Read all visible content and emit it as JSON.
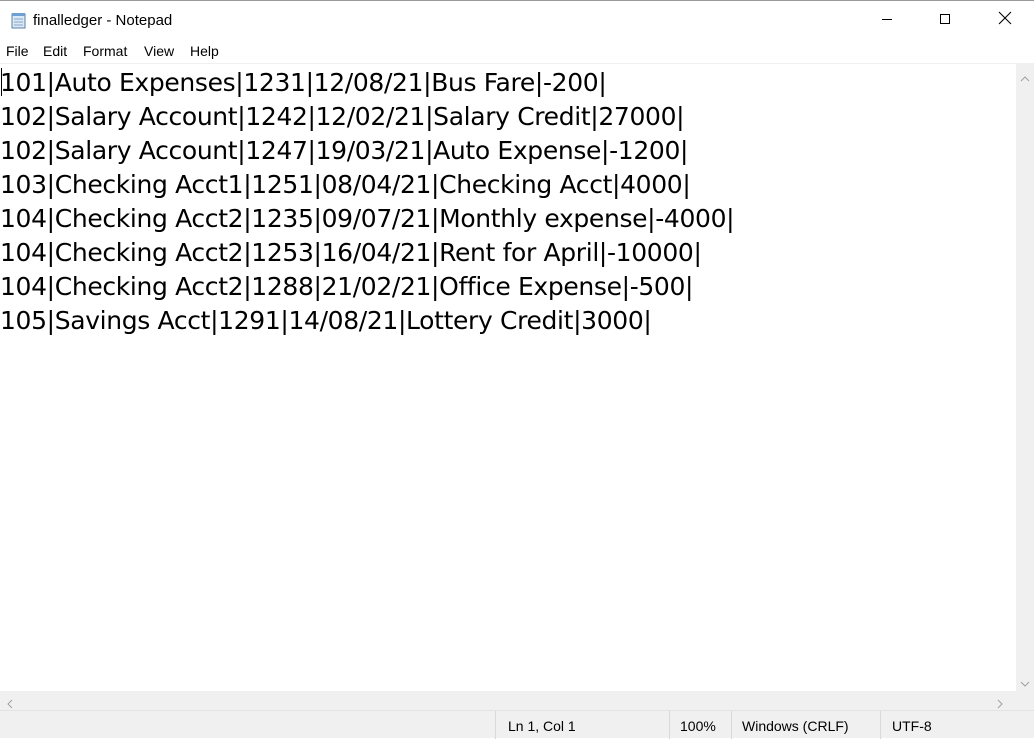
{
  "window": {
    "title": "finalledger - Notepad",
    "icon": "notepad-icon"
  },
  "controls": {
    "minimize_icon": "minimize-icon",
    "maximize_icon": "maximize-icon",
    "close_icon": "close-icon"
  },
  "menu": {
    "items": [
      "File",
      "Edit",
      "Format",
      "View",
      "Help"
    ]
  },
  "editor": {
    "lines": [
      "101|Auto Expenses|1231|12/08/21|Bus Fare|-200|",
      "102|Salary Account|1242|12/02/21|Salary Credit|27000|",
      "102|Salary Account|1247|19/03/21|Auto Expense|-1200|",
      "103|Checking Acct1|1251|08/04/21|Checking Acct|4000|",
      "104|Checking Acct2|1235|09/07/21|Monthly expense|-4000|",
      "104|Checking Acct2|1253|16/04/21|Rent for April|-10000|",
      "104|Checking Acct2|1288|21/02/21|Office Expense|-500|",
      "105|Savings Acct|1291|14/08/21|Lottery Credit|3000|"
    ]
  },
  "status": {
    "position": "Ln 1, Col 1",
    "zoom": "100%",
    "line_ending": "Windows (CRLF)",
    "encoding": "UTF-8"
  },
  "colors": {
    "chrome": "#f0f0f0",
    "text": "#000000"
  }
}
